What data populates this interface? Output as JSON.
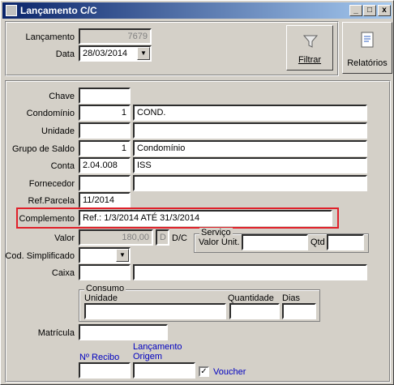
{
  "window": {
    "title": "Lançamento C/C",
    "minimize": "_",
    "maximize": "□",
    "close": "x"
  },
  "header": {
    "lancamento_label": "Lançamento",
    "lancamento_value": "7679",
    "data_label": "Data",
    "data_value": "28/03/2014",
    "filtrar_label": "Filtrar",
    "relatorios_label": "Relatórios"
  },
  "form": {
    "chave": {
      "label": "Chave",
      "value": ""
    },
    "condominio": {
      "label": "Condomínio",
      "code": "1",
      "name": "COND."
    },
    "unidade": {
      "label": "Unidade",
      "code": "",
      "name": ""
    },
    "grupo_saldo": {
      "label": "Grupo de Saldo",
      "code": "1",
      "name": "Condomínio"
    },
    "conta": {
      "label": "Conta",
      "code": "2.04.008",
      "name": "ISS"
    },
    "fornecedor": {
      "label": "Fornecedor",
      "code": "",
      "name": ""
    },
    "ref_parcela": {
      "label": "Ref.Parcela",
      "value": "11/2014"
    },
    "complemento": {
      "label": "Complemento",
      "value": "Ref.: 1/3/2014 ATÉ 31/3/2014"
    },
    "valor": {
      "label": "Valor",
      "value": "180,00",
      "dc_value": "D",
      "dc_label": "D/C"
    },
    "servico": {
      "title": "Serviço",
      "valor_unit_label": "Valor Unit.",
      "valor_unit_value": "",
      "qtd_label": "Qtd",
      "qtd_value": ""
    },
    "cod_simplificado": {
      "label": "Cod. Simplificado",
      "value": ""
    },
    "caixa": {
      "label": "Caixa",
      "code": "",
      "name": ""
    },
    "consumo": {
      "title": "Consumo",
      "unidade_label": "Unidade",
      "quantidade_label": "Quantidade",
      "dias_label": "Dias"
    },
    "matricula": {
      "label": "Matrícula",
      "value": ""
    },
    "nr_recibo": {
      "label": "Nº Recibo",
      "value": ""
    },
    "lancamento_origem": {
      "label_line1": "Lançamento",
      "label_line2": "Origem",
      "value": ""
    },
    "voucher": {
      "label": "Voucher",
      "checked": "✓"
    }
  },
  "colors": {
    "title_start": "#0a246a",
    "title_end": "#a6caf0",
    "highlight": "#e0202a",
    "link": "#0000c0"
  },
  "icons": [
    "filter-icon",
    "report-icon",
    "app-icon"
  ]
}
